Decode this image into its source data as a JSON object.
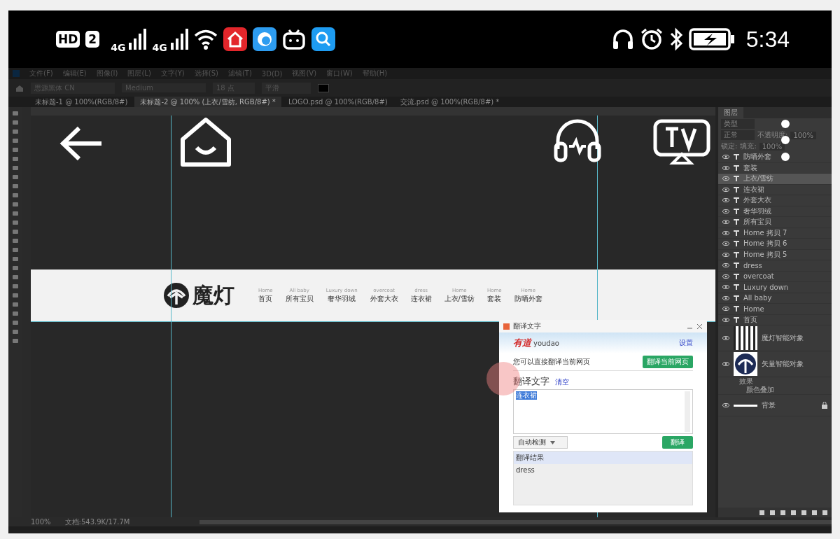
{
  "status_bar": {
    "badge": "HD",
    "sim": "2",
    "networks": [
      {
        "label": "4G"
      },
      {
        "label": "4G"
      }
    ],
    "time": "5:34"
  },
  "menu_bar": [
    "文件(F)",
    "编辑(E)",
    "图像(I)",
    "图层(L)",
    "文字(Y)",
    "选择(S)",
    "滤镜(T)",
    "3D(D)",
    "视图(V)",
    "窗口(W)",
    "帮助(H)"
  ],
  "options_bar": {
    "font": "思源黑体 CN",
    "style": "Medium",
    "size": "18 点",
    "antialias": "平滑"
  },
  "document_tabs": [
    {
      "label": "未标题-1 @ 100%(RGB/8#)",
      "selected": false
    },
    {
      "label": "未标题-2 @ 100% (上衣/雪纺, RGB/8#) *",
      "selected": true
    },
    {
      "label": "LOGO.psd @ 100%(RGB/8#)",
      "selected": false
    },
    {
      "label": "交流.psd @ 100%(RGB/8#) *",
      "selected": false
    }
  ],
  "canvas": {
    "logo": "魔灯",
    "nav": [
      {
        "en": "Home",
        "zh": "首页"
      },
      {
        "en": "All baby",
        "zh": "所有宝贝"
      },
      {
        "en": "Luxury down",
        "zh": "奢华羽绒"
      },
      {
        "en": "overcoat",
        "zh": "外套大衣"
      },
      {
        "en": "dress",
        "zh": "连衣裙"
      },
      {
        "en": "Home",
        "zh": "上衣/雪纺"
      },
      {
        "en": "Home",
        "zh": "套装"
      },
      {
        "en": "Home",
        "zh": "防晒外套"
      }
    ]
  },
  "layers_panel": {
    "tabs": [
      {
        "label": "图层",
        "selected": true
      }
    ],
    "filter": "类型",
    "blend_mode": "正常",
    "opacity_label": "不透明度:",
    "opacity": "100%",
    "lock_label": "锁定:",
    "fill_label": "填充:",
    "fill": "100%",
    "layers": [
      {
        "name": "防晒外套",
        "kind": "text",
        "selected": false
      },
      {
        "name": "套装",
        "kind": "text",
        "selected": false
      },
      {
        "name": "上衣/雪纺",
        "kind": "text",
        "selected": true
      },
      {
        "name": "连衣裙",
        "kind": "text",
        "selected": false
      },
      {
        "name": "外套大衣",
        "kind": "text",
        "selected": false
      },
      {
        "name": "奢华羽绒",
        "kind": "text",
        "selected": false
      },
      {
        "name": "所有宝贝",
        "kind": "text",
        "selected": false
      },
      {
        "name": "Home 拷贝 7",
        "kind": "text",
        "selected": false
      },
      {
        "name": "Home 拷贝 6",
        "kind": "text",
        "selected": false
      },
      {
        "name": "Home 拷贝 5",
        "kind": "text",
        "selected": false
      },
      {
        "name": "dress",
        "kind": "text",
        "selected": false
      },
      {
        "name": "overcoat",
        "kind": "text",
        "selected": false
      },
      {
        "name": "Luxury down",
        "kind": "text",
        "selected": false
      },
      {
        "name": "All baby",
        "kind": "text",
        "selected": false
      },
      {
        "name": "Home",
        "kind": "text",
        "selected": false
      },
      {
        "name": "首页",
        "kind": "text",
        "selected": false
      },
      {
        "name": "魔灯智能对象",
        "kind": "smart",
        "selected": false
      },
      {
        "name": "矢量智能对象",
        "kind": "vector",
        "selected": false,
        "children": [
          {
            "name": "效果",
            "children": [
              {
                "name": "颜色叠加"
              }
            ]
          }
        ]
      },
      {
        "name": "背景",
        "kind": "background",
        "selected": false
      }
    ]
  },
  "translate_dialog": {
    "title": "翻译文字",
    "brand": "有道",
    "brand_latin": "youdao",
    "settings": "设置",
    "hint": "您可以直接翻译当前网页",
    "page_button": "翻译当前网页",
    "heading": "翻译文字",
    "clear": "清空",
    "input": "连衣裙",
    "language": "自动检测",
    "translate_button": "翻译",
    "result_label": "翻译结果",
    "result": "dress"
  },
  "document_status": {
    "zoom": "100%",
    "info": "文档:543.9K/17.7M"
  }
}
